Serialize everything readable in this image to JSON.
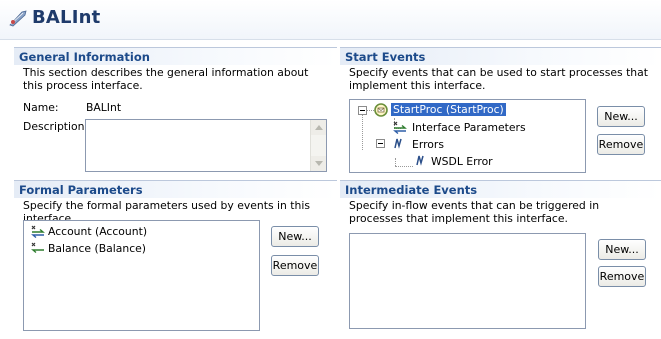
{
  "header": {
    "title": "BALInt",
    "icon": "interface-feather-icon"
  },
  "general": {
    "title": "General Information",
    "description": "This section describes the general information about this process interface.",
    "name_label": "Name:",
    "name_value": "BALInt",
    "description_label": "Description:",
    "description_value": ""
  },
  "start_events": {
    "title": "Start Events",
    "description": "Specify events that can be used to start processes that implement this interface.",
    "tree": {
      "root": "StartProc (StartProc)",
      "interface_parameters": "Interface Parameters",
      "errors": "Errors",
      "wsdl_error": "WSDL Error"
    },
    "new_button": "New...",
    "remove_button": "Remove"
  },
  "formal_parameters": {
    "title": "Formal Parameters",
    "description": "Specify the formal parameters used by events in this interface.",
    "items": [
      "Account (Account)",
      "Balance (Balance)"
    ],
    "new_button": "New...",
    "remove_button": "Remove"
  },
  "intermediate_events": {
    "title": "Intermediate Events",
    "description": "Specify in-flow events that can be triggered in processes that implement this interface.",
    "new_button": "New...",
    "remove_button": "Remove"
  },
  "colors": {
    "section_title": "#1c4a8a",
    "header_title": "#1f3b6b",
    "selection": "#3169c6"
  }
}
